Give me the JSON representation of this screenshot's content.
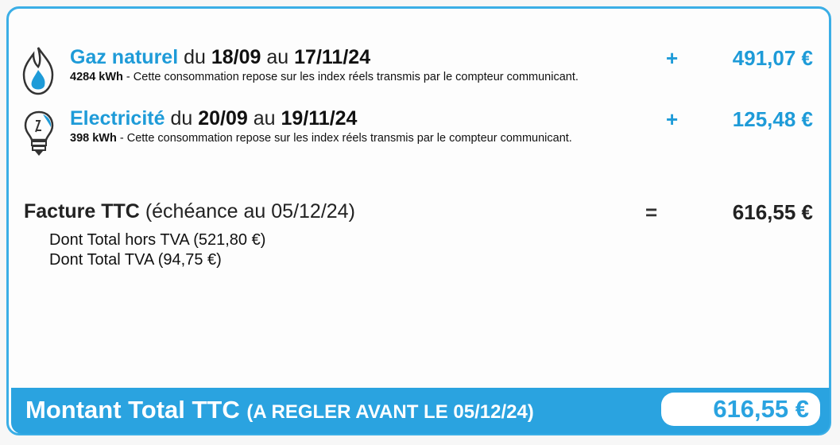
{
  "gas": {
    "icon": "flame-icon",
    "name": "Gaz naturel",
    "du": "du",
    "start": "18/09",
    "au": "au",
    "end": "17/11/24",
    "kwh": "4284 kWh",
    "desc": " - Cette consommation repose sur les index réels transmis par le compteur communicant.",
    "op": "+",
    "amount": "491,07 €"
  },
  "electricity": {
    "icon": "lightbulb-icon",
    "name": "Electricité",
    "du": "du",
    "start": "20/09",
    "au": "au",
    "end": "19/11/24",
    "kwh": "398 kWh",
    "desc": " - Cette consommation repose sur les index réels transmis par le compteur communicant.",
    "op": "+",
    "amount": "125,48 €"
  },
  "facture": {
    "label": "Facture TTC",
    "due": "(échéance au 05/12/24)",
    "op": "=",
    "amount": "616,55 €",
    "ht": "Dont Total hors TVA (521,80 €)",
    "tva": "Dont Total TVA (94,75 €)"
  },
  "footer": {
    "label": "Montant Total TTC",
    "condition": "(A REGLER AVANT LE 05/12/24)",
    "amount": "616,55 €"
  },
  "colors": {
    "accent": "#2aa3e0",
    "border": "#3aaee6"
  }
}
